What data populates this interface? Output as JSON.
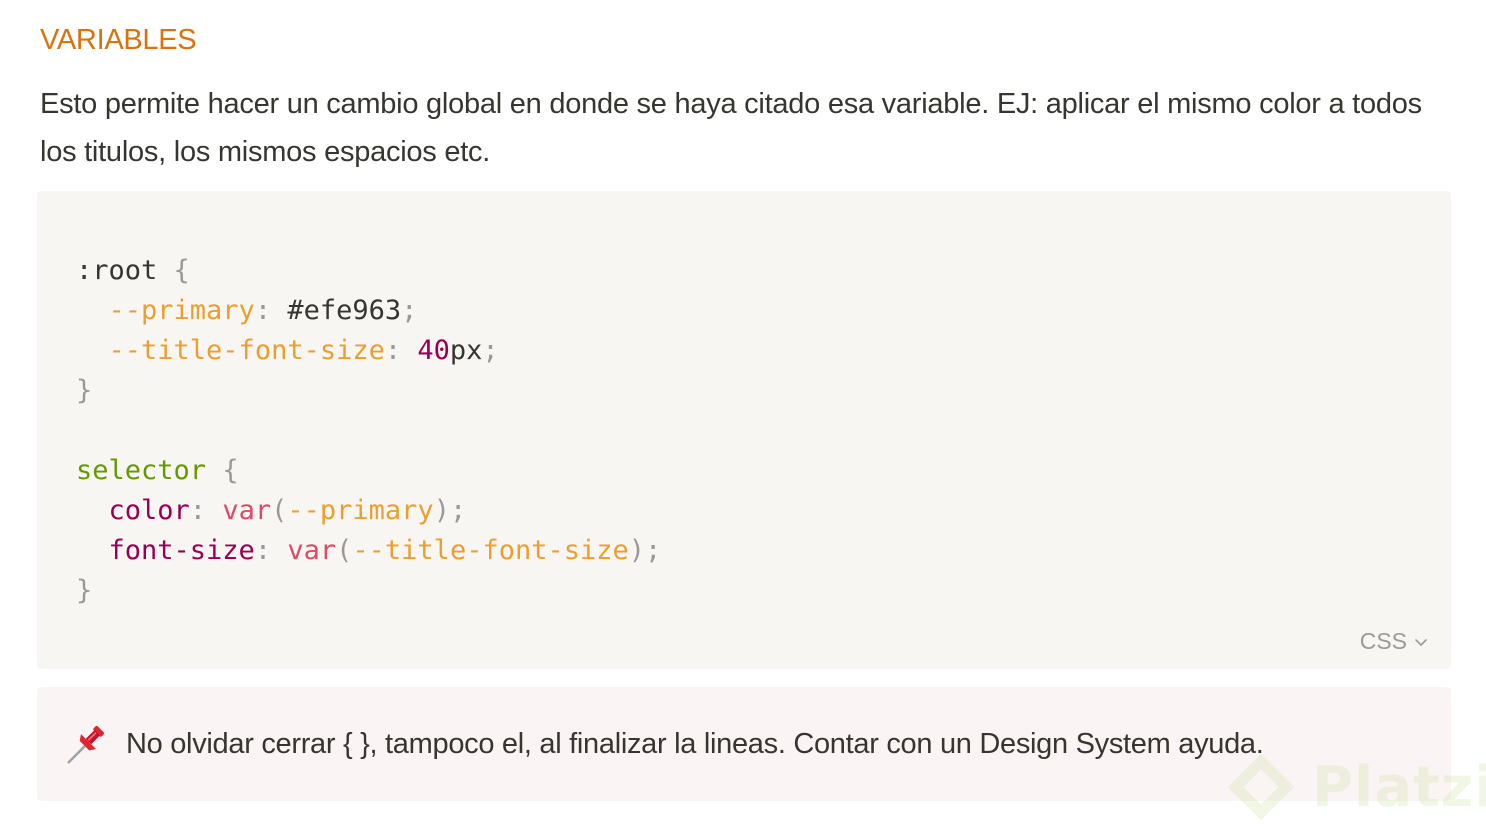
{
  "section": {
    "heading": "VARIABLES",
    "paragraph": "Esto permite hacer un cambio global en donde se haya citado esa variable. EJ: aplicar el mismo color a todos los titulos, los mismos espacios etc."
  },
  "code_block": {
    "language_label": "CSS",
    "tokens": {
      "root_selector": ":root",
      "brace_open": "{",
      "brace_close": "}",
      "colon": ":",
      "semicolon": ";",
      "paren_open": "(",
      "paren_close": ")",
      "var_primary": "--primary",
      "value_primary": " #efe963",
      "var_title_font_size": "--title-font-size",
      "value_size_number": "40",
      "value_size_unit": "px",
      "selector": "selector",
      "prop_color": "color",
      "prop_font_size": "font-size",
      "fn_var": "var"
    }
  },
  "callout": {
    "icon": "pushpin-icon",
    "text": "No olvidar cerrar { }, tampoco el, al finalizar la lineas. Contar con un Design System ayuda."
  },
  "watermark": {
    "text": "Platzi",
    "color": "#98ca3f"
  }
}
